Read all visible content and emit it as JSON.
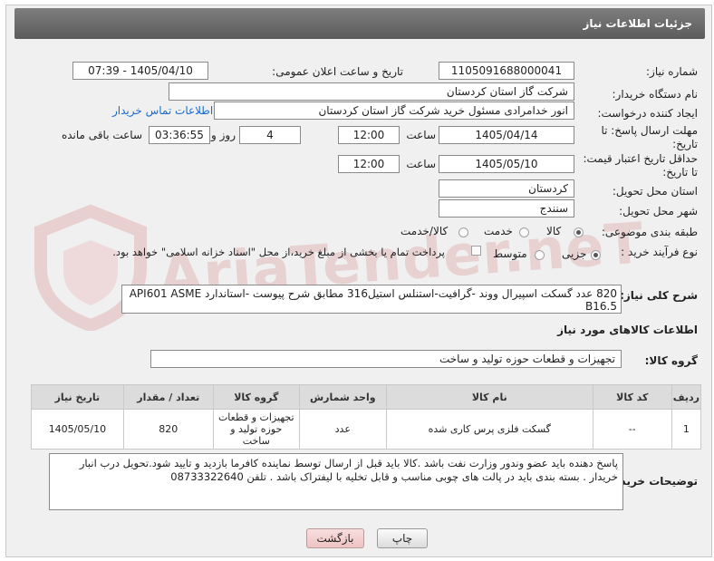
{
  "header": {
    "title": "جزئیات اطلاعات نیاز"
  },
  "watermark": {
    "text": "AriaTender.neT"
  },
  "fields": {
    "need_number": {
      "label": "شماره نیاز:",
      "value": "1105091688000041"
    },
    "announce_datetime": {
      "label": "تاریخ و ساعت اعلان عمومی:",
      "value": "1405/04/10 - 07:39"
    },
    "buyer_org": {
      "label": "نام دستگاه خریدار:",
      "value": "شرکت گاز استان کردستان"
    },
    "requester": {
      "label": "ایجاد کننده درخواست:",
      "value": "انور خدامرادی مسئول خرید  شرکت گاز استان کردستان",
      "contact_link": "اطلاعات تماس خریدار"
    },
    "reply_deadline": {
      "label_line1": "مهلت ارسال پاسخ: تا",
      "label_line2": "تاریخ:",
      "date": "1405/04/14",
      "time_label": "ساعت",
      "time": "12:00",
      "days": "4",
      "days_label": "روز و",
      "remaining": "03:36:55",
      "remaining_label": "ساعت باقی مانده"
    },
    "price_validity": {
      "label_line1": "حداقل تاریخ اعتبار قیمت:",
      "label_line2": "تا تاریخ:",
      "date": "1405/05/10",
      "time_label": "ساعت",
      "time": "12:00"
    },
    "delivery_province": {
      "label": "استان محل تحویل:",
      "value": "کردستان"
    },
    "delivery_city": {
      "label": "شهر محل تحویل:",
      "value": "سنندج"
    },
    "category": {
      "label": "طبقه بندی موضوعی:",
      "options": [
        "کالا",
        "خدمت",
        "کالا/خدمت"
      ],
      "selected": "کالا"
    },
    "process_type": {
      "label": "نوع فرآیند خرید :",
      "options": [
        "جزیی",
        "متوسط"
      ],
      "selected": "جزیی",
      "payment_note": "پرداخت تمام یا بخشی از مبلغ خرید،از محل \"اسناد خزانه اسلامی\" خواهد بود."
    }
  },
  "summary": {
    "label": "شرح کلی نیاز:",
    "line1": "820 عدد گسکت اسپیرال ووند -گرافیت-استنلس استیل316 مطابق شرح پیوست -استاندارد  API601 ASME",
    "line2": "B16.5"
  },
  "goods_section": {
    "title": "اطلاعات کالاهای مورد نیاز",
    "group_label": "گروه کالا:",
    "group_value": "تجهیزات و قطعات حوزه تولید و ساخت"
  },
  "table": {
    "headers": [
      "ردیف",
      "کد کالا",
      "نام کالا",
      "واحد شمارش",
      "گروه کالا",
      "تعداد / مقدار",
      "تاریخ نیاز"
    ],
    "rows": [
      {
        "row": "1",
        "code": "--",
        "name": "گسکت فلزی پرس کاری شده",
        "unit": "عدد",
        "group_line1": "تجهیزات و قطعات",
        "group_line2": "حوزه تولید و",
        "group_line3": "ساخت",
        "qty": "820",
        "date": "1405/05/10"
      }
    ]
  },
  "buyer_notes": {
    "label": "توضیحات خریدار:",
    "line1": "پاسخ دهنده باید عضو وندور وزارت نفت باشد .کالا باید قبل از ارسال توسط نماینده کافرما بازدید و تایید شود.تحویل درب انبار",
    "line2": "خریدار . بسته بندی باید در پالت های چوبی مناسب و قابل تخلیه با لیفتراک باشد . تلفن 08733322640"
  },
  "buttons": {
    "print": "چاپ",
    "back": "بازگشت"
  },
  "colors": {
    "titlebar": "#6b6b6b",
    "link": "#1a6bd0",
    "back_button_bg": "#f3cfcf"
  }
}
